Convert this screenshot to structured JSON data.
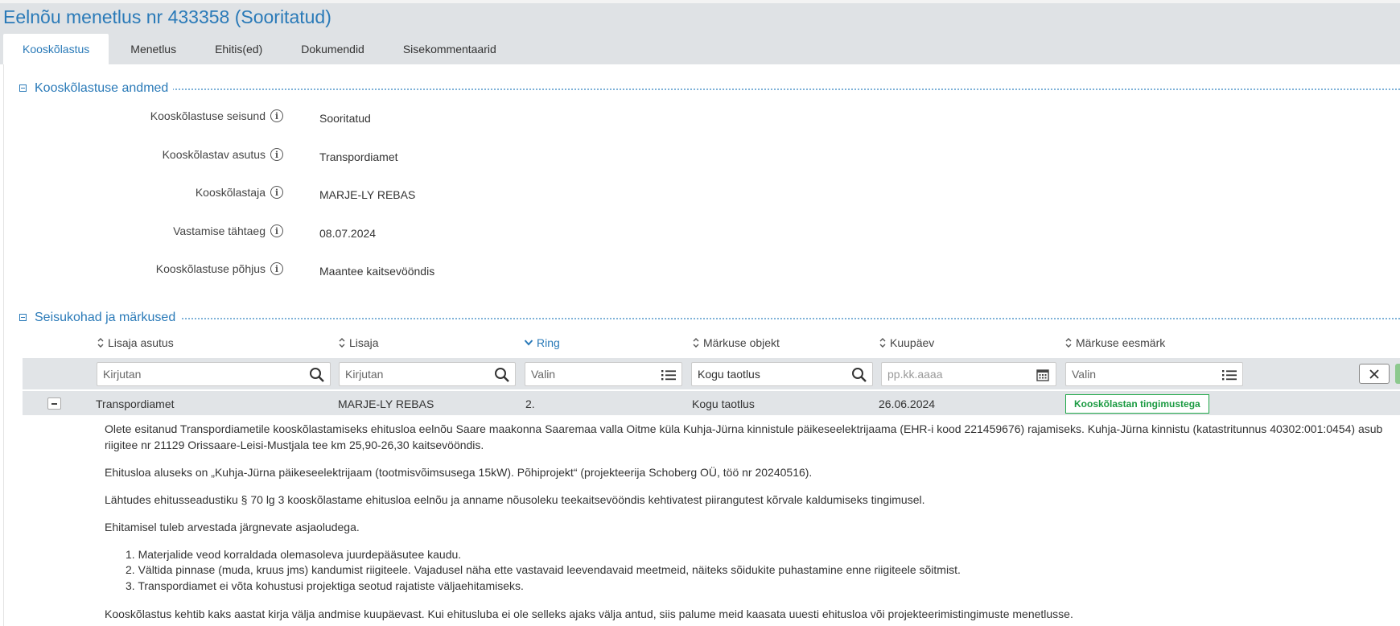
{
  "page": {
    "title": "Eelnõu menetlus nr 433358 (Sooritatud)"
  },
  "tabs": [
    {
      "label": "Kooskõlastus",
      "active": true
    },
    {
      "label": "Menetlus",
      "active": false
    },
    {
      "label": "Ehitis(ed)",
      "active": false
    },
    {
      "label": "Dokumendid",
      "active": false
    },
    {
      "label": "Sisekommentaarid",
      "active": false
    }
  ],
  "section1": {
    "title": "Kooskõlastuse andmed",
    "fields": [
      {
        "label": "Kooskõlastuse seisund",
        "value": "Sooritatud"
      },
      {
        "label": "Kooskõlastav asutus",
        "value": "Transpordiamet"
      },
      {
        "label": "Kooskõlastaja",
        "value": "MARJE-LY REBAS"
      },
      {
        "label": "Vastamise tähtaeg",
        "value": "08.07.2024"
      },
      {
        "label": "Kooskõlastuse põhjus",
        "value": "Maantee kaitsevööndis"
      }
    ]
  },
  "section2": {
    "title": "Seisukohad ja märkused",
    "columns": [
      "Lisaja asutus",
      "Lisaja",
      "Ring",
      "Märkuse objekt",
      "Kuupäev",
      "Märkuse eesmärk"
    ],
    "filters": {
      "lisaja_asutus_placeholder": "Kirjutan",
      "lisaja_placeholder": "Kirjutan",
      "ring_placeholder": "Valin",
      "objekt_value": "Kogu taotlus",
      "kuupaev_placeholder": "pp.kk.aaaa",
      "eesmark_placeholder": "Valin"
    },
    "row": {
      "asutus": "Transpordiamet",
      "lisaja": "MARJE-LY REBAS",
      "ring": "2.",
      "objekt": "Kogu taotlus",
      "kuupaev": "26.06.2024",
      "eesmark": "Kooskõlastan tingimustega"
    },
    "comment": {
      "p1_line1": "Olete esitanud Transpordiametile kooskõlastamiseks ehitusloa eelnõu Saare maakonna Saaremaa valla Oitme küla Kuhja-Jürna kinnistule päikeseelektrijaama (EHR-i kood 221459676) rajamiseks. Kuhja-Jürna kinnistu (katastritunnus 40302:001:0454) asub",
      "p1_line2": "riigitee nr 21129 Orissaare-Leisi-Mustjala tee km 25,90-26,30 kaitsevööndis.",
      "p2": "Ehitusloa aluseks on „Kuhja-Jürna päikeseelektrijaam (tootmisvõimsusega 15kW). Põhiprojekt“ (projekteerija Schoberg OÜ, töö nr 20240516).",
      "p3": "Lähtudes ehitusseadustiku § 70 lg 3 kooskõlastame ehitusloa eelnõu ja anname nõusoleku teekaitsevööndis kehtivatest piirangutest kõrvale kaldumiseks tingimusel.",
      "p4": "Ehitamisel tuleb arvestada järgnevate asjaoludega.",
      "list": [
        "1. Materjalide veod korraldada olemasoleva juurdepääsutee kaudu.",
        "2. Vältida pinnase (muda, kruus jms) kandumist riigiteele. Vajadusel näha ette vastavaid leevendavaid meetmeid, näiteks sõidukite puhastamine enne riigiteele sõitmist.",
        "3. Transpordiamet ei võta kohustusi projektiga seotud rajatiste väljaehitamiseks."
      ],
      "p5": "Kooskõlastus kehtib kaks aastat kirja välja andmise kuupäevast. Kui ehitusluba ei ole selleks ajaks välja antud, siis palume meid kaasata uuesti ehitusloa või projekteerimistingimuste menetlusse."
    }
  },
  "colors": {
    "accent": "#2a7ab8",
    "header_bg": "#dfe2e5",
    "badge_green": "#20a849"
  }
}
